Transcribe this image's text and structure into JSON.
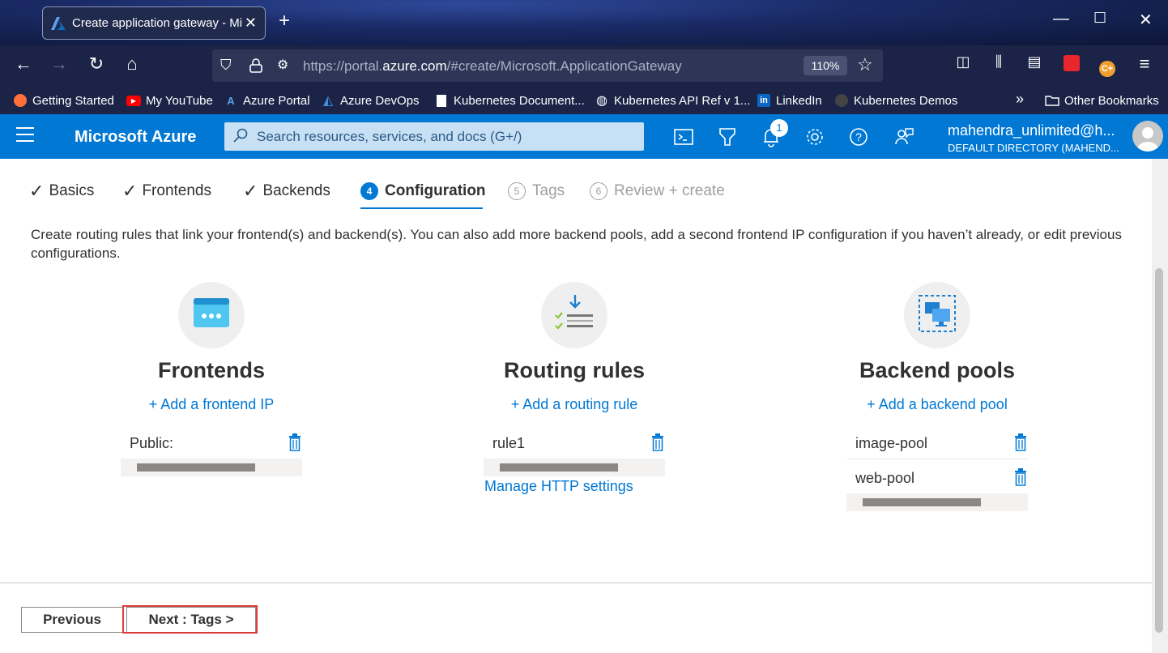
{
  "browser": {
    "tab_title": "Create application gateway - Microsoft Azure",
    "url_prefix": "https://portal.",
    "url_domain": "azure.com",
    "url_suffix": "/#create/Microsoft.ApplicationGateway",
    "zoom": "110%",
    "bookmarks": [
      {
        "label": "Getting Started",
        "icon": "firefox-icon"
      },
      {
        "label": "My YouTube",
        "icon": "youtube-icon"
      },
      {
        "label": "Azure Portal",
        "icon": "azure-icon"
      },
      {
        "label": "Azure DevOps",
        "icon": "devops-icon"
      },
      {
        "label": "Kubernetes Document...",
        "icon": "document-icon"
      },
      {
        "label": "Kubernetes API Ref v 1...",
        "icon": "globe-icon"
      },
      {
        "label": "LinkedIn",
        "icon": "linkedin-icon"
      },
      {
        "label": "Kubernetes Demos",
        "icon": "github-icon"
      }
    ],
    "other_bookmarks": "Other Bookmarks"
  },
  "azure": {
    "brand": "Microsoft Azure",
    "search_placeholder": "Search resources, services, and docs (G+/)",
    "notification_count": "1",
    "user_name": "mahendra_unlimited@h...",
    "user_directory": "DEFAULT DIRECTORY (MAHEND..."
  },
  "steps": [
    {
      "label": "Basics",
      "state": "done"
    },
    {
      "label": "Frontends",
      "state": "done"
    },
    {
      "label": "Backends",
      "state": "done"
    },
    {
      "label": "Configuration",
      "state": "active",
      "num": "4"
    },
    {
      "label": "Tags",
      "state": "pending",
      "num": "5"
    },
    {
      "label": "Review + create",
      "state": "pending",
      "num": "6"
    }
  ],
  "description": "Create routing rules that link your frontend(s) and backend(s). You can also add more backend pools, add a second frontend IP configuration if you haven’t already, or edit previous configurations.",
  "frontends": {
    "title": "Frontends",
    "add_link": "+ Add a frontend IP",
    "items": [
      "Public:"
    ]
  },
  "routing": {
    "title": "Routing rules",
    "add_link": "+ Add a routing rule",
    "items": [
      "rule1"
    ],
    "manage_link": "Manage HTTP settings"
  },
  "backends": {
    "title": "Backend pools",
    "add_link": "+ Add a backend pool",
    "items": [
      "image-pool",
      "web-pool"
    ]
  },
  "footer": {
    "previous": "Previous",
    "next": "Next : Tags >"
  },
  "colors": {
    "azure_blue": "#0078d4",
    "highlight": "#e03a3a"
  }
}
